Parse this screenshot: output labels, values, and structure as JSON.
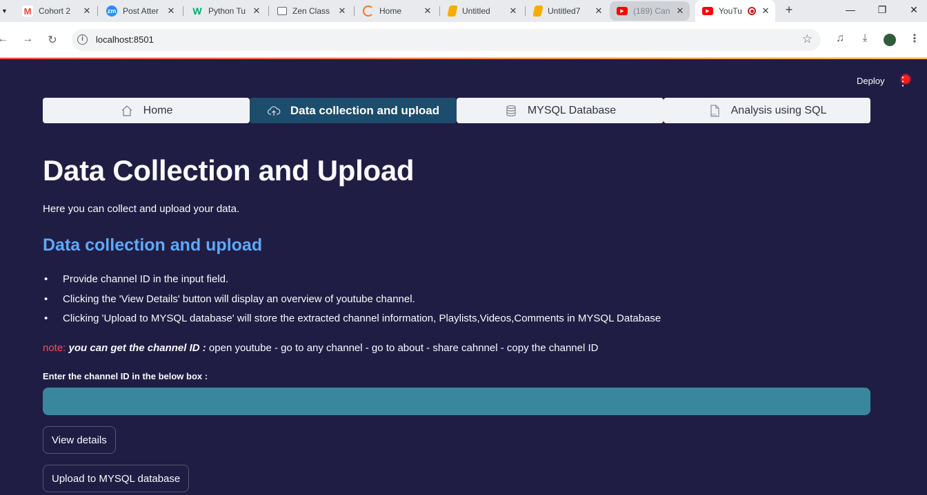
{
  "browser": {
    "tabs": [
      {
        "title": "Cohort 2",
        "icon": "gmail-icon",
        "color": "#ea4335"
      },
      {
        "title": "Post Atter",
        "icon": "zoom-icon",
        "color": "#2d8cff",
        "glyph": "zm"
      },
      {
        "title": "Python Tu",
        "icon": "w3schools-icon",
        "color": "#04aa6d",
        "glyph": "W"
      },
      {
        "title": "Zen Class",
        "icon": "page-icon",
        "color": "#5f6368"
      },
      {
        "title": "Home",
        "icon": "jupyter-icon",
        "color": "#f37626"
      },
      {
        "title": "Untitled",
        "icon": "colab-icon",
        "color": "#f9ab00"
      },
      {
        "title": "Untitled7",
        "icon": "colab-icon",
        "color": "#f9ab00"
      },
      {
        "title": "(189) Can",
        "icon": "youtube-icon",
        "color": "#ff0000"
      },
      {
        "title": "YouTu",
        "icon": "youtube-icon",
        "color": "#ff0000"
      }
    ],
    "url": "localhost:8501"
  },
  "header": {
    "deploy_label": "Deploy"
  },
  "nav": {
    "items": [
      {
        "label": "Home",
        "icon": "house-icon"
      },
      {
        "label": "Data collection and upload",
        "icon": "cloud-upload-icon"
      },
      {
        "label": "MYSQL Database",
        "icon": "database-icon"
      },
      {
        "label": "Analysis using SQL",
        "icon": "sql-file-icon"
      }
    ],
    "selected_index": 1,
    "selected_color": "#1d4d6c"
  },
  "main": {
    "title": "Data Collection and Upload",
    "intro": "Here you can collect and upload your data.",
    "subheader": "Data collection and upload",
    "bullets": [
      "Provide channel ID in the input field.",
      "Clicking the 'View Details' button will display an overview of youtube channel.",
      "Clicking 'Upload to MYSQL database' will store the extracted channel information, Playlists,Videos,Comments in MYSQL Database"
    ],
    "note": {
      "label": "note:",
      "emphasis": "you can get the channel ID :",
      "text": "open youtube - go to any channel - go to about - share cahnnel - copy the channel ID"
    },
    "input": {
      "label": "Enter the channel ID in the below box :",
      "value": "",
      "background": "#3a879d"
    },
    "buttons": {
      "view_details": "View details",
      "upload": "Upload to MYSQL database"
    }
  }
}
